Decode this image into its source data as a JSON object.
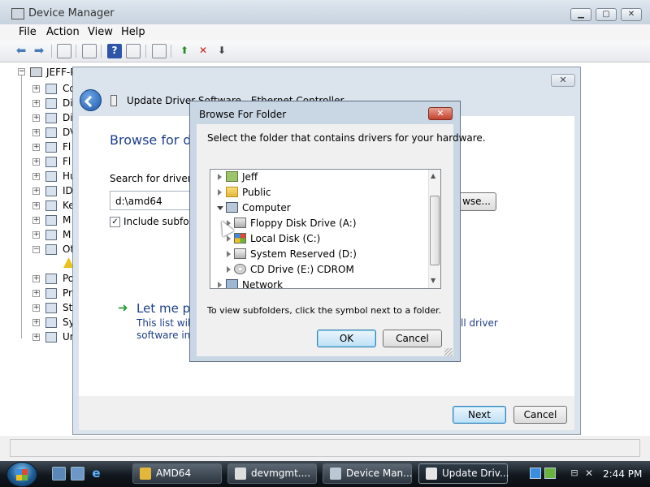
{
  "device_manager": {
    "title": "Device Manager",
    "menu": [
      "File",
      "Action",
      "View",
      "Help"
    ],
    "toolbar_icons": [
      "back-arrow-icon",
      "forward-arrow-icon",
      "properties-icon",
      "show-hidden-icon",
      "help-icon",
      "device-list-icon",
      "scan-hardware-icon",
      "update-driver-icon",
      "uninstall-icon",
      "disable-icon"
    ],
    "tree": {
      "root_label": "JEFF-P",
      "items": [
        "Co",
        "Di",
        "Di",
        "DV",
        "Fl",
        "Fl",
        "Hu",
        "ID",
        "Ke",
        "M",
        "M",
        "Ot",
        "",
        "Po",
        "Pr",
        "St",
        "Sy",
        "Ur"
      ]
    }
  },
  "wizard": {
    "title": "Update Driver Software - Ethernet Controller",
    "heading": "Browse for dri",
    "search_label": "Search for driver so",
    "path_value": "d:\\amd64",
    "browse_button": "wse...",
    "include_subfolders_label": "Include subfold",
    "include_subfolders_checked": true,
    "pick_heading": "Let me pi",
    "pick_desc_line1": "This list will s",
    "pick_desc_line1_tail": "ll driver",
    "pick_desc_line2": "software in t",
    "next_button": "Next",
    "cancel_button": "Cancel"
  },
  "browse_dialog": {
    "title": "Browse For Folder",
    "instruction": "Select the folder that contains drivers for your hardware.",
    "folders": [
      {
        "label": "Jeff",
        "expanded": false,
        "icon": "user-folder-icon"
      },
      {
        "label": "Public",
        "expanded": false,
        "icon": "folder-icon"
      },
      {
        "label": "Computer",
        "expanded": true,
        "icon": "computer-icon"
      },
      {
        "label": "Floppy Disk Drive (A:)",
        "expanded": false,
        "icon": "floppy-drive-icon"
      },
      {
        "label": "Local Disk (C:)",
        "expanded": false,
        "icon": "windows-drive-icon"
      },
      {
        "label": "System Reserved (D:)",
        "expanded": false,
        "icon": "hard-drive-icon"
      },
      {
        "label": "CD Drive (E:) CDROM",
        "expanded": false,
        "icon": "cd-drive-icon"
      },
      {
        "label": "Network",
        "expanded": false,
        "icon": "network-icon"
      }
    ],
    "hint": "To view subfolders, click the symbol next to a folder.",
    "ok_button": "OK",
    "cancel_button": "Cancel"
  },
  "taskbar": {
    "tasks": [
      {
        "label": "AMD64",
        "icon": "folder-icon",
        "active": false
      },
      {
        "label": "devmgmt....",
        "icon": "document-icon",
        "active": false
      },
      {
        "label": "Device Man...",
        "icon": "device-manager-icon",
        "active": false
      },
      {
        "label": "Update Driv...",
        "icon": "driver-icon",
        "active": true
      }
    ],
    "clock": "2:44 PM"
  }
}
